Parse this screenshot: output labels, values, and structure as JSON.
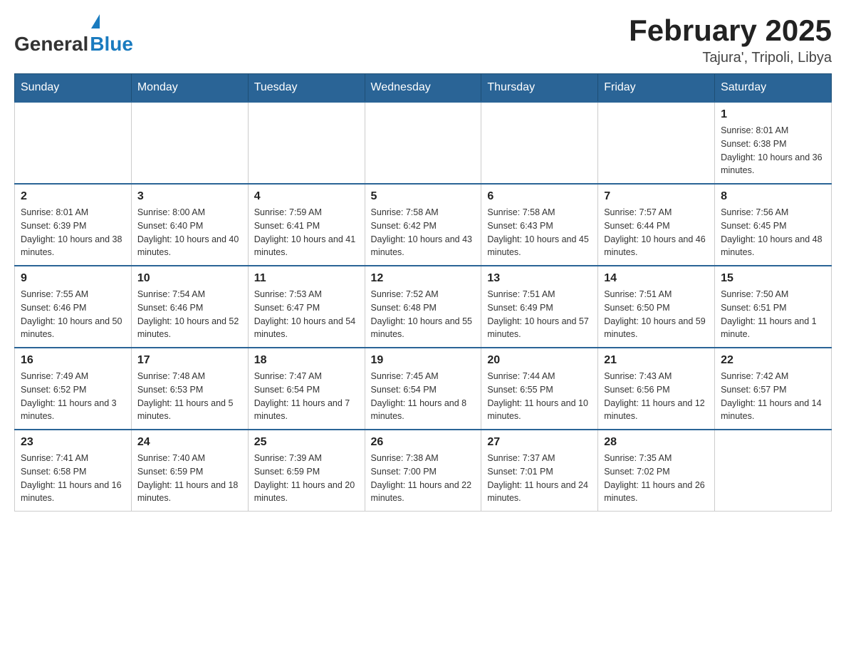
{
  "header": {
    "logo_general": "General",
    "logo_blue": "Blue",
    "month_year": "February 2025",
    "location": "Tajura', Tripoli, Libya"
  },
  "weekdays": [
    "Sunday",
    "Monday",
    "Tuesday",
    "Wednesday",
    "Thursday",
    "Friday",
    "Saturday"
  ],
  "weeks": [
    [
      {
        "day": "",
        "sunrise": "",
        "sunset": "",
        "daylight": ""
      },
      {
        "day": "",
        "sunrise": "",
        "sunset": "",
        "daylight": ""
      },
      {
        "day": "",
        "sunrise": "",
        "sunset": "",
        "daylight": ""
      },
      {
        "day": "",
        "sunrise": "",
        "sunset": "",
        "daylight": ""
      },
      {
        "day": "",
        "sunrise": "",
        "sunset": "",
        "daylight": ""
      },
      {
        "day": "",
        "sunrise": "",
        "sunset": "",
        "daylight": ""
      },
      {
        "day": "1",
        "sunrise": "Sunrise: 8:01 AM",
        "sunset": "Sunset: 6:38 PM",
        "daylight": "Daylight: 10 hours and 36 minutes."
      }
    ],
    [
      {
        "day": "2",
        "sunrise": "Sunrise: 8:01 AM",
        "sunset": "Sunset: 6:39 PM",
        "daylight": "Daylight: 10 hours and 38 minutes."
      },
      {
        "day": "3",
        "sunrise": "Sunrise: 8:00 AM",
        "sunset": "Sunset: 6:40 PM",
        "daylight": "Daylight: 10 hours and 40 minutes."
      },
      {
        "day": "4",
        "sunrise": "Sunrise: 7:59 AM",
        "sunset": "Sunset: 6:41 PM",
        "daylight": "Daylight: 10 hours and 41 minutes."
      },
      {
        "day": "5",
        "sunrise": "Sunrise: 7:58 AM",
        "sunset": "Sunset: 6:42 PM",
        "daylight": "Daylight: 10 hours and 43 minutes."
      },
      {
        "day": "6",
        "sunrise": "Sunrise: 7:58 AM",
        "sunset": "Sunset: 6:43 PM",
        "daylight": "Daylight: 10 hours and 45 minutes."
      },
      {
        "day": "7",
        "sunrise": "Sunrise: 7:57 AM",
        "sunset": "Sunset: 6:44 PM",
        "daylight": "Daylight: 10 hours and 46 minutes."
      },
      {
        "day": "8",
        "sunrise": "Sunrise: 7:56 AM",
        "sunset": "Sunset: 6:45 PM",
        "daylight": "Daylight: 10 hours and 48 minutes."
      }
    ],
    [
      {
        "day": "9",
        "sunrise": "Sunrise: 7:55 AM",
        "sunset": "Sunset: 6:46 PM",
        "daylight": "Daylight: 10 hours and 50 minutes."
      },
      {
        "day": "10",
        "sunrise": "Sunrise: 7:54 AM",
        "sunset": "Sunset: 6:46 PM",
        "daylight": "Daylight: 10 hours and 52 minutes."
      },
      {
        "day": "11",
        "sunrise": "Sunrise: 7:53 AM",
        "sunset": "Sunset: 6:47 PM",
        "daylight": "Daylight: 10 hours and 54 minutes."
      },
      {
        "day": "12",
        "sunrise": "Sunrise: 7:52 AM",
        "sunset": "Sunset: 6:48 PM",
        "daylight": "Daylight: 10 hours and 55 minutes."
      },
      {
        "day": "13",
        "sunrise": "Sunrise: 7:51 AM",
        "sunset": "Sunset: 6:49 PM",
        "daylight": "Daylight: 10 hours and 57 minutes."
      },
      {
        "day": "14",
        "sunrise": "Sunrise: 7:51 AM",
        "sunset": "Sunset: 6:50 PM",
        "daylight": "Daylight: 10 hours and 59 minutes."
      },
      {
        "day": "15",
        "sunrise": "Sunrise: 7:50 AM",
        "sunset": "Sunset: 6:51 PM",
        "daylight": "Daylight: 11 hours and 1 minute."
      }
    ],
    [
      {
        "day": "16",
        "sunrise": "Sunrise: 7:49 AM",
        "sunset": "Sunset: 6:52 PM",
        "daylight": "Daylight: 11 hours and 3 minutes."
      },
      {
        "day": "17",
        "sunrise": "Sunrise: 7:48 AM",
        "sunset": "Sunset: 6:53 PM",
        "daylight": "Daylight: 11 hours and 5 minutes."
      },
      {
        "day": "18",
        "sunrise": "Sunrise: 7:47 AM",
        "sunset": "Sunset: 6:54 PM",
        "daylight": "Daylight: 11 hours and 7 minutes."
      },
      {
        "day": "19",
        "sunrise": "Sunrise: 7:45 AM",
        "sunset": "Sunset: 6:54 PM",
        "daylight": "Daylight: 11 hours and 8 minutes."
      },
      {
        "day": "20",
        "sunrise": "Sunrise: 7:44 AM",
        "sunset": "Sunset: 6:55 PM",
        "daylight": "Daylight: 11 hours and 10 minutes."
      },
      {
        "day": "21",
        "sunrise": "Sunrise: 7:43 AM",
        "sunset": "Sunset: 6:56 PM",
        "daylight": "Daylight: 11 hours and 12 minutes."
      },
      {
        "day": "22",
        "sunrise": "Sunrise: 7:42 AM",
        "sunset": "Sunset: 6:57 PM",
        "daylight": "Daylight: 11 hours and 14 minutes."
      }
    ],
    [
      {
        "day": "23",
        "sunrise": "Sunrise: 7:41 AM",
        "sunset": "Sunset: 6:58 PM",
        "daylight": "Daylight: 11 hours and 16 minutes."
      },
      {
        "day": "24",
        "sunrise": "Sunrise: 7:40 AM",
        "sunset": "Sunset: 6:59 PM",
        "daylight": "Daylight: 11 hours and 18 minutes."
      },
      {
        "day": "25",
        "sunrise": "Sunrise: 7:39 AM",
        "sunset": "Sunset: 6:59 PM",
        "daylight": "Daylight: 11 hours and 20 minutes."
      },
      {
        "day": "26",
        "sunrise": "Sunrise: 7:38 AM",
        "sunset": "Sunset: 7:00 PM",
        "daylight": "Daylight: 11 hours and 22 minutes."
      },
      {
        "day": "27",
        "sunrise": "Sunrise: 7:37 AM",
        "sunset": "Sunset: 7:01 PM",
        "daylight": "Daylight: 11 hours and 24 minutes."
      },
      {
        "day": "28",
        "sunrise": "Sunrise: 7:35 AM",
        "sunset": "Sunset: 7:02 PM",
        "daylight": "Daylight: 11 hours and 26 minutes."
      },
      {
        "day": "",
        "sunrise": "",
        "sunset": "",
        "daylight": ""
      }
    ]
  ]
}
